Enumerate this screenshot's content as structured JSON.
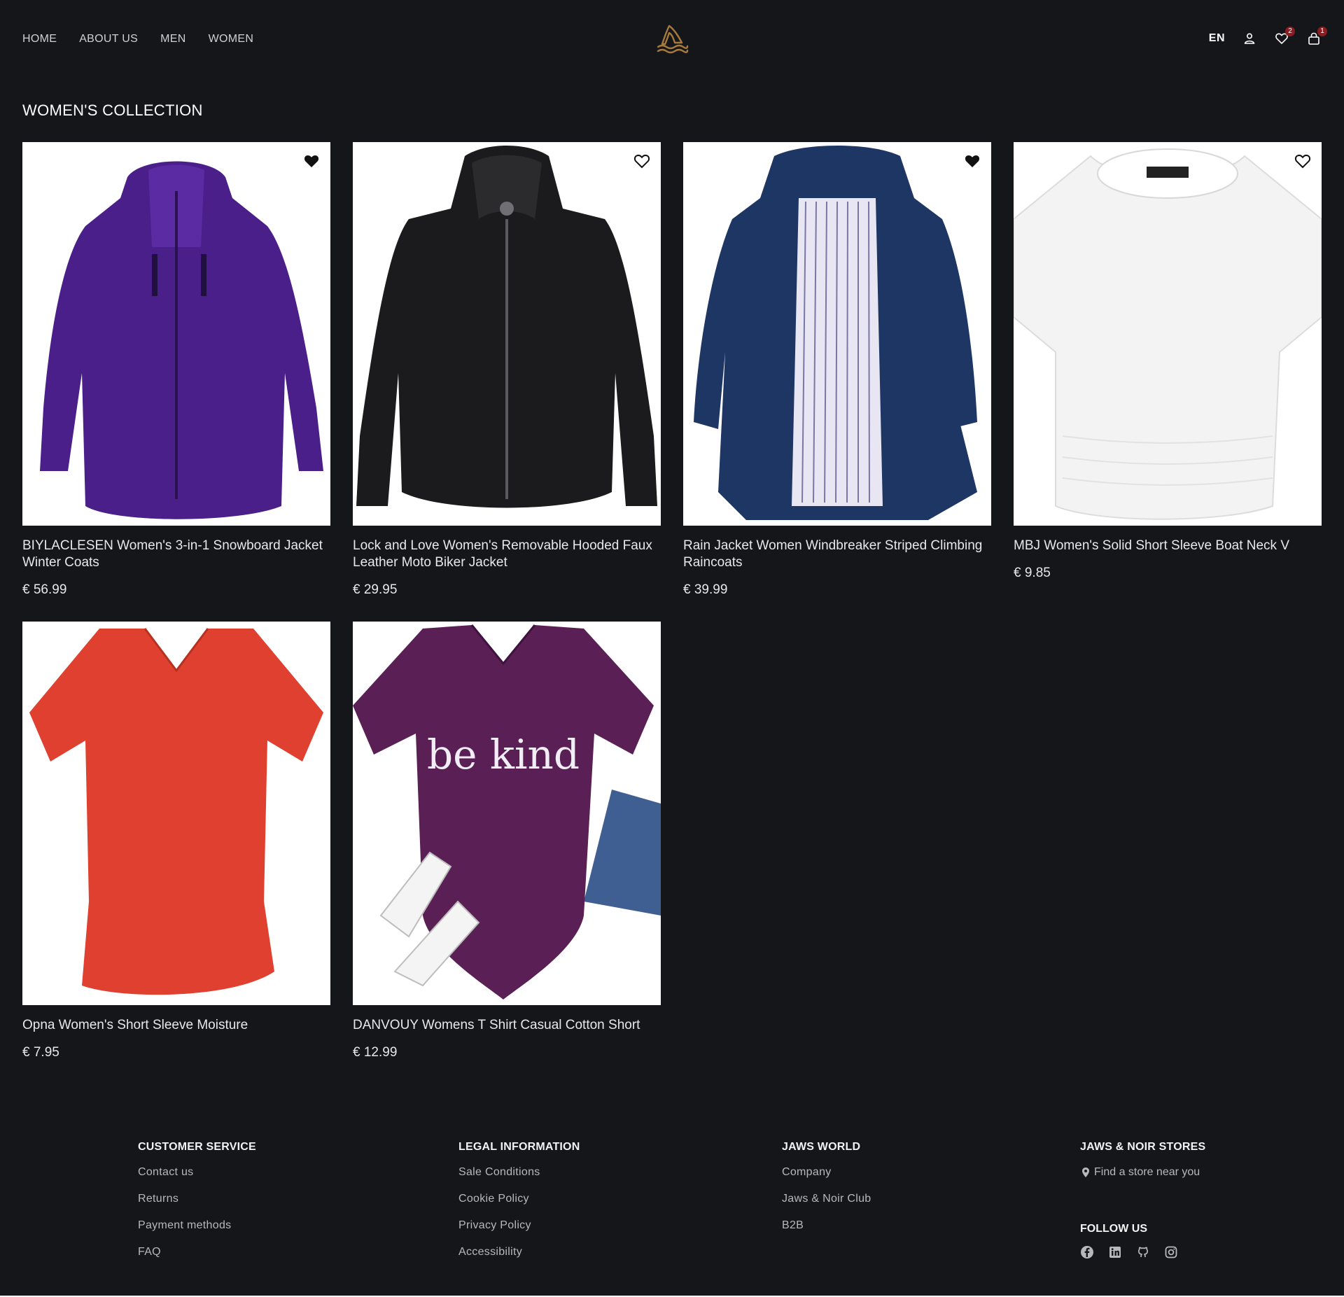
{
  "header": {
    "nav": [
      "HOME",
      "ABOUT US",
      "MEN",
      "WOMEN"
    ],
    "language": "EN",
    "wishlist_count": "2",
    "cart_count": "1",
    "logo_color": "#a67a3b"
  },
  "page": {
    "title": "WOMEN'S COLLECTION"
  },
  "products": [
    {
      "name": "BIYLACLESEN Women's 3-in-1 Snowboard Jacket Winter Coats",
      "price": "€ 56.99",
      "favorited": true,
      "image": "purple-jacket"
    },
    {
      "name": "Lock and Love Women's Removable Hooded Faux Leather Moto Biker Jacket",
      "price": "€ 29.95",
      "favorited": false,
      "image": "black-leather-jacket"
    },
    {
      "name": "Rain Jacket Women Windbreaker Striped Climbing Raincoats",
      "price": "€ 39.99",
      "favorited": true,
      "image": "navy-raincoat"
    },
    {
      "name": "MBJ Women's Solid Short Sleeve Boat Neck V",
      "price": "€ 9.85",
      "favorited": false,
      "image": "white-tshirt"
    },
    {
      "name": "Opna Women's Short Sleeve Moisture",
      "price": "€ 7.95",
      "favorited": false,
      "image": "red-tshirt"
    },
    {
      "name": "DANVOUY Womens T Shirt Casual Cotton Short",
      "price": "€ 12.99",
      "favorited": false,
      "image": "purple-be-kind-tshirt",
      "print": "be kind"
    }
  ],
  "footer": {
    "customer_service": {
      "title": "CUSTOMER SERVICE",
      "links": [
        "Contact us",
        "Returns",
        "Payment methods",
        "FAQ"
      ]
    },
    "legal": {
      "title": "LEGAL INFORMATION",
      "links": [
        "Sale Conditions",
        "Cookie Policy",
        "Privacy Policy",
        "Accessibility"
      ]
    },
    "world": {
      "title": "JAWS WORLD",
      "links": [
        "Company",
        "Jaws & Noir Club",
        "B2B"
      ]
    },
    "stores": {
      "title": "JAWS & NOIR STORES",
      "link": "Find a store near you"
    },
    "follow": {
      "title": "FOLLOW US",
      "icons": [
        "facebook-icon",
        "linkedin-icon",
        "github-icon",
        "instagram-icon"
      ]
    }
  }
}
